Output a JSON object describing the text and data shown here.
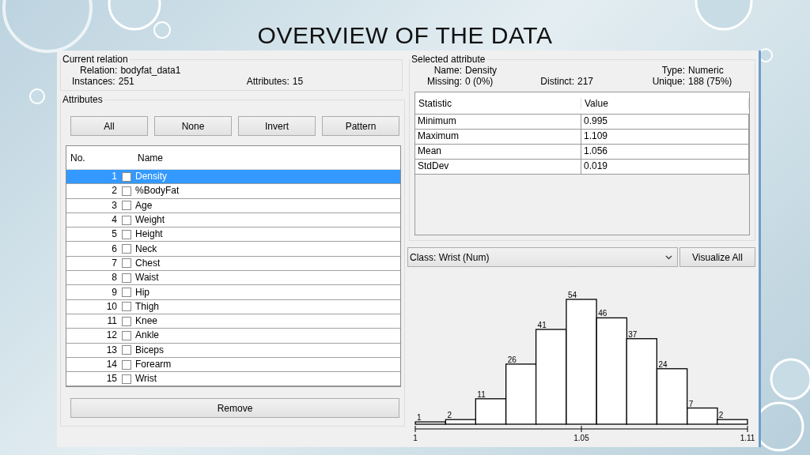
{
  "slide_title": "OVERVIEW OF THE DATA",
  "current_relation": {
    "legend": "Current relation",
    "relation_label": "Relation:",
    "relation": "bodyfat_data1",
    "instances_label": "Instances:",
    "instances": "251",
    "attributes_label": "Attributes:",
    "attributes": "15"
  },
  "attributes": {
    "legend": "Attributes",
    "buttons": [
      "All",
      "None",
      "Invert",
      "Pattern"
    ],
    "columns": [
      "No.",
      "Name"
    ],
    "rows": [
      {
        "no": "1",
        "name": "Density",
        "checked": false,
        "selected": true
      },
      {
        "no": "2",
        "name": "%BodyFat",
        "checked": false,
        "selected": false
      },
      {
        "no": "3",
        "name": "Age",
        "checked": false,
        "selected": false
      },
      {
        "no": "4",
        "name": "Weight",
        "checked": false,
        "selected": false
      },
      {
        "no": "5",
        "name": "Height",
        "checked": false,
        "selected": false
      },
      {
        "no": "6",
        "name": "Neck",
        "checked": false,
        "selected": false
      },
      {
        "no": "7",
        "name": "Chest",
        "checked": false,
        "selected": false
      },
      {
        "no": "8",
        "name": "Waist",
        "checked": false,
        "selected": false
      },
      {
        "no": "9",
        "name": "Hip",
        "checked": false,
        "selected": false
      },
      {
        "no": "10",
        "name": "Thigh",
        "checked": false,
        "selected": false
      },
      {
        "no": "11",
        "name": "Knee",
        "checked": false,
        "selected": false
      },
      {
        "no": "12",
        "name": "Ankle",
        "checked": false,
        "selected": false
      },
      {
        "no": "13",
        "name": "Biceps",
        "checked": false,
        "selected": false
      },
      {
        "no": "14",
        "name": "Forearm",
        "checked": false,
        "selected": false
      },
      {
        "no": "15",
        "name": "Wrist",
        "checked": false,
        "selected": false
      }
    ],
    "remove_button": "Remove"
  },
  "selected_attribute": {
    "legend": "Selected attribute",
    "name_label": "Name:",
    "name": "Density",
    "type_label": "Type:",
    "type": "Numeric",
    "missing_label": "Missing:",
    "missing": "0 (0%)",
    "distinct_label": "Distinct:",
    "distinct": "217",
    "unique_label": "Unique:",
    "unique": "188 (75%)",
    "stats": {
      "columns": [
        "Statistic",
        "Value"
      ],
      "rows": [
        {
          "statistic": "Minimum",
          "value": "0.995"
        },
        {
          "statistic": "Maximum",
          "value": "1.109"
        },
        {
          "statistic": "Mean",
          "value": "1.056"
        },
        {
          "statistic": "StdDev",
          "value": "0.019"
        }
      ]
    }
  },
  "class_dropdown": {
    "value": "Class: Wrist (Num)"
  },
  "visualize_all_button": "Visualize All",
  "histogram": {
    "chart_data": {
      "type": "bar",
      "values": [
        1,
        2,
        11,
        26,
        41,
        54,
        46,
        37,
        24,
        7,
        2
      ],
      "xlim": [
        0.995,
        1.109
      ],
      "xticks": [
        {
          "value": 0.995,
          "label": "1"
        },
        {
          "value": 1.052,
          "label": "1.05"
        },
        {
          "value": 1.109,
          "label": "1.11"
        }
      ],
      "data_labels": true,
      "x": [
        1.0002,
        1.0106,
        1.0209,
        1.0313,
        1.0416,
        1.052,
        1.0624,
        1.0727,
        1.0831,
        1.0935,
        1.1038
      ]
    }
  }
}
